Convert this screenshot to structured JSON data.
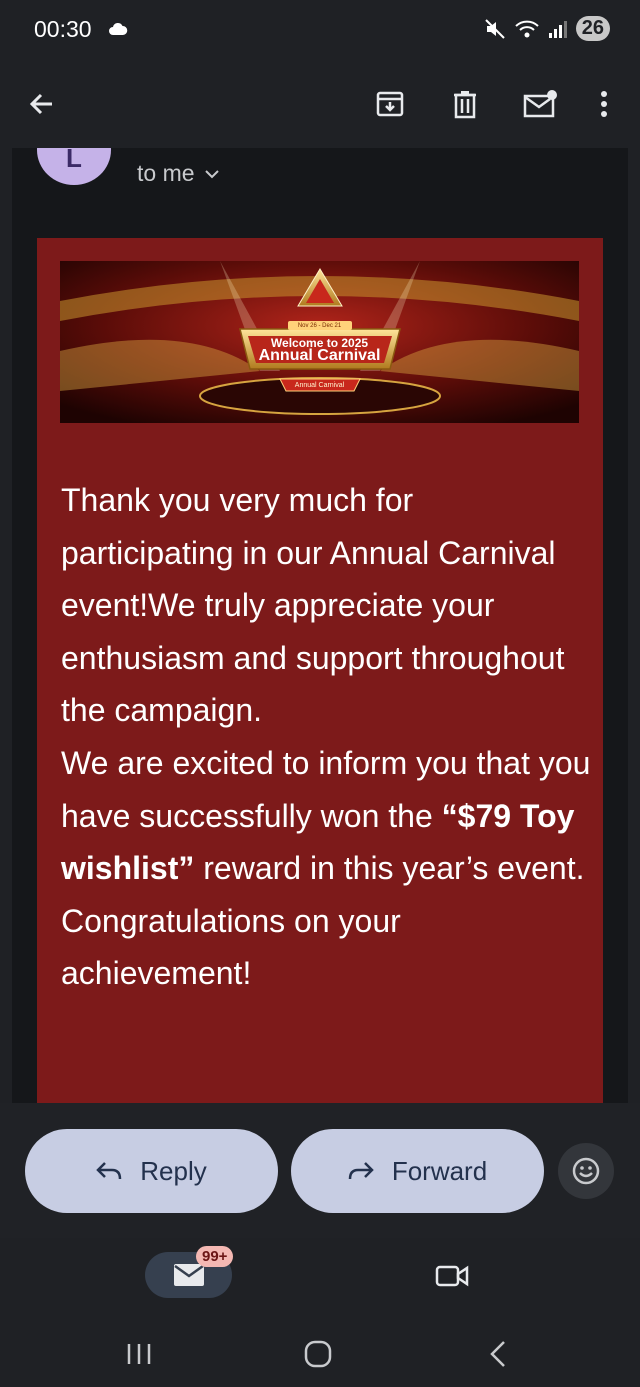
{
  "status_bar": {
    "time": "00:30",
    "battery": "26"
  },
  "email": {
    "recipient_label": "to me",
    "banner": {
      "date_range": "Nov 26 - Dec 21",
      "title_line1": "Welcome to 2025",
      "title_line2": "Annual Carnival",
      "ribbon": "Annual Carnival"
    },
    "body": {
      "paragraph1": "Thank you very much for participating in our Annual Carnival event!We truly appreciate your enthusiasm and support throughout the campaign.",
      "paragraph2_before": "We are excited to inform you that you have successfully won the ",
      "reward_name": "“$79 Toy wishlist”",
      "paragraph2_after": " reward in this year’s event. Congratulations on your achievement!"
    }
  },
  "actions": {
    "reply_label": "Reply",
    "forward_label": "Forward"
  },
  "bottom_nav": {
    "mail_badge": "99+"
  },
  "colors": {
    "email_background": "#7d1a1a",
    "app_background": "#1f2125",
    "button_fill": "#c7cde3"
  }
}
